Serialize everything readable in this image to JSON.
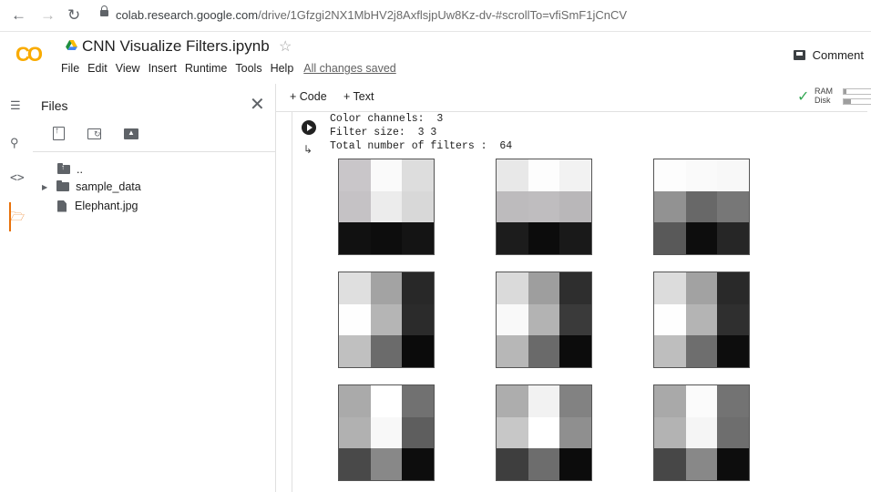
{
  "browser": {
    "url_host": "colab.research.google.com",
    "url_path": "/drive/1Gfzgi2NX1MbHV2j8AxflsjpUw8Kz-dv-#scrollTo=vfiSmF1jCnCV"
  },
  "header": {
    "logo": "CO",
    "title": "CNN Visualize Filters.ipynb",
    "menu": [
      "File",
      "Edit",
      "View",
      "Insert",
      "Runtime",
      "Tools",
      "Help"
    ],
    "save_status": "All changes saved",
    "comment_label": "Comment"
  },
  "files_panel": {
    "title": "Files",
    "items": [
      {
        "name": "..",
        "type": "parent-folder"
      },
      {
        "name": "sample_data",
        "type": "folder"
      },
      {
        "name": "Elephant.jpg",
        "type": "file"
      }
    ]
  },
  "toolbar": {
    "add_code": "+ Code",
    "add_text": "+ Text",
    "ram_label": "RAM",
    "disk_label": "Disk",
    "ram_usage": 0.1,
    "disk_usage": 0.25
  },
  "output": {
    "lines": [
      "Color channels:  3",
      "Filter size:  3 3",
      "Total number of filters :  64"
    ],
    "filters": [
      {
        "pixels": [
          "#c9c6c9",
          "#fafafa",
          "#dddddd",
          "#c5c2c5",
          "#ececec",
          "#d8d8d8",
          "#111111",
          "#0d0d0d",
          "#141414"
        ]
      },
      {
        "pixels": [
          "#e8e8e8",
          "#fdfdfd",
          "#f2f2f2",
          "#bdbbbd",
          "#bfbdbf",
          "#b9b7b9",
          "#1c1c1c",
          "#0c0c0c",
          "#191919"
        ]
      },
      {
        "pixels": [
          "#fdfdfd",
          "#fafafa",
          "#f8f8f8",
          "#929292",
          "#686868",
          "#777777",
          "#595959",
          "#0d0d0d",
          "#262626"
        ]
      },
      {
        "pixels": [
          "#dfdfdf",
          "#a3a3a3",
          "#282828",
          "#fefefe",
          "#b5b5b5",
          "#2b2b2b",
          "#c0c0c0",
          "#6b6b6b",
          "#0b0b0b"
        ]
      },
      {
        "pixels": [
          "#dadada",
          "#9e9e9e",
          "#2e2e2e",
          "#f9f9f9",
          "#b3b3b3",
          "#3a3a3a",
          "#b7b7b7",
          "#6a6a6a",
          "#0c0c0c"
        ]
      },
      {
        "pixels": [
          "#dcdcdc",
          "#a2a2a2",
          "#292929",
          "#fefefe",
          "#b4b4b4",
          "#2f2f2f",
          "#bebebe",
          "#6e6e6e",
          "#0d0d0d"
        ]
      },
      {
        "pixels": [
          "#aaaaaa",
          "#ffffff",
          "#717171",
          "#b1b1b1",
          "#f8f8f8",
          "#5e5e5e",
          "#494949",
          "#888888",
          "#0d0d0d"
        ]
      },
      {
        "pixels": [
          "#adadad",
          "#f2f2f2",
          "#828282",
          "#c7c7c7",
          "#ffffff",
          "#8f8f8f",
          "#3e3e3e",
          "#6d6d6d",
          "#0c0c0c"
        ]
      },
      {
        "pixels": [
          "#a9a9a9",
          "#fbfbfb",
          "#737373",
          "#b3b3b3",
          "#f5f5f5",
          "#6e6e6e",
          "#474747",
          "#888888",
          "#0d0d0d"
        ]
      }
    ]
  },
  "colors": {
    "accent_orange": "#e8710a",
    "accent_yellow": "#f9ab00",
    "ok_green": "#34a853"
  }
}
